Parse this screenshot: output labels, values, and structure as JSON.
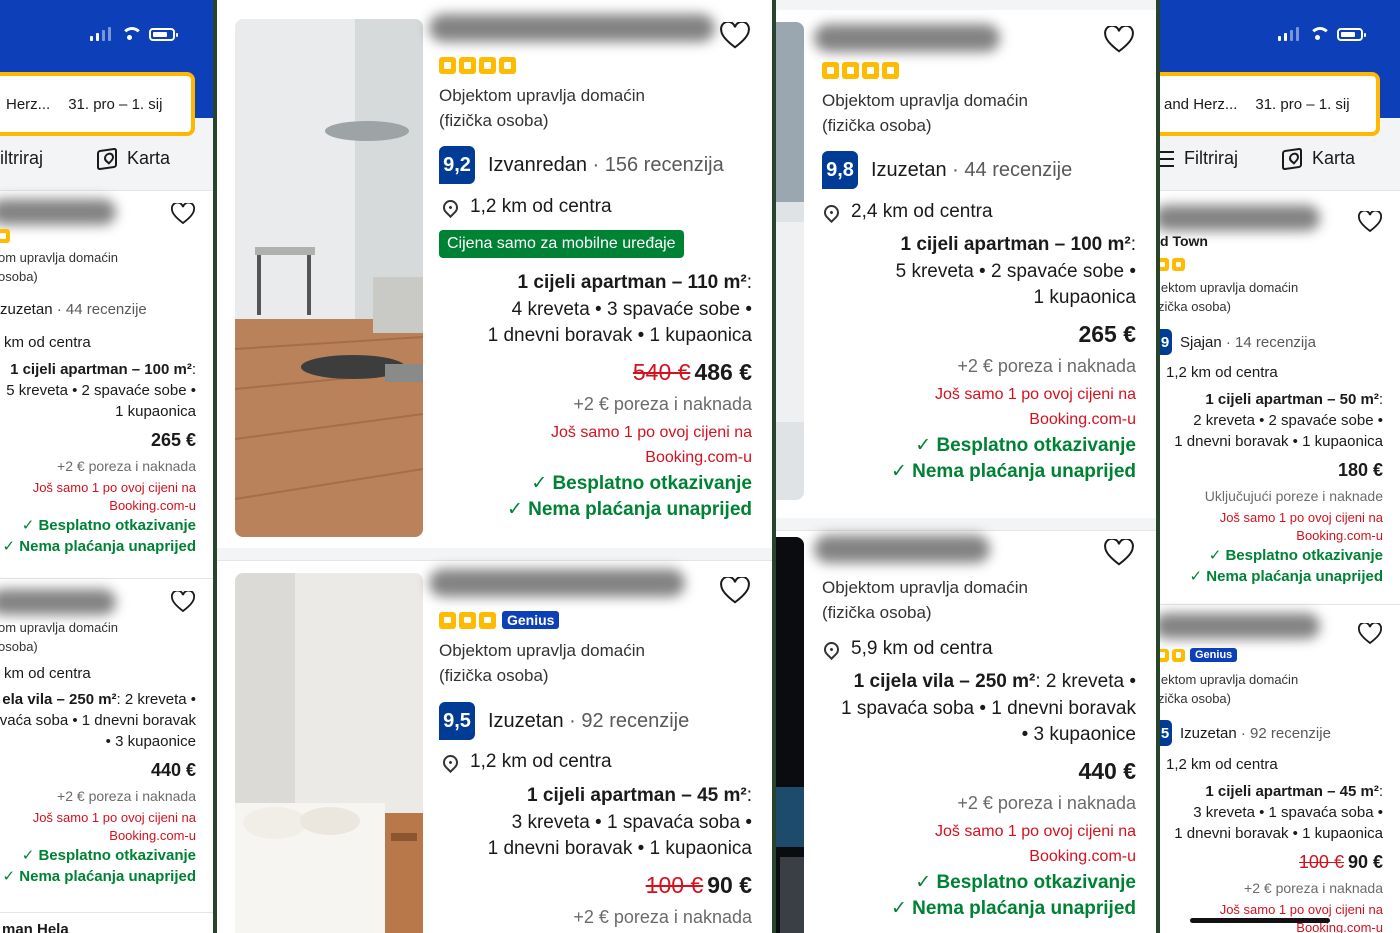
{
  "colors": {
    "booking_blue": "#0d3fb8",
    "score_blue": "#003b95",
    "search_border": "#ffb700",
    "star_yellow": "#febb02",
    "green": "#008234",
    "red": "#d4111e"
  },
  "icons": [
    "signal-icon",
    "wifi-icon",
    "battery-icon",
    "filter-icon",
    "map-icon",
    "heart-icon",
    "location-pin-icon",
    "check-icon",
    "star-icon"
  ],
  "panel1": {
    "search": {
      "place": "Herz...",
      "dates": "31. pro  –  1. sij"
    },
    "toolbar": {
      "filter": "iltriraj",
      "map": "Karta"
    },
    "cards": [
      {
        "host": "om upravlja domaćin",
        "host2": "osoba)",
        "rating_word": "zuzetan",
        "reviews": "· 44 recenzije",
        "distance": "km od centra",
        "unit": "1 cijeli apartman – 100 m²",
        "unit_tail": ":",
        "line2": "5 kreveta • 2 spavaće sobe •",
        "line3": "1 kupaonica",
        "price": "265 €",
        "tax": "+2 € poreza i naknada",
        "scarce1": "Još samo 1 po ovoj cijeni na",
        "scarce2": "Booking.com-u",
        "free_cancel": "Besplatno otkazivanje",
        "no_prepay": "Nema plaćanja unaprijed"
      },
      {
        "host": "om upravlja domaćin",
        "host2": "osoba)",
        "distance": "km od centra",
        "unit": "ela vila – 250 m²",
        "unit_tail": ": 2 kreveta •",
        "line2": "vaća soba • 1 dnevni boravak",
        "line3": "• 3 kupaonice",
        "price": "440 €",
        "tax": "+2 € poreza i naknada",
        "scarce1": "Još samo 1 po ovoj cijeni na",
        "scarce2": "Booking.com-u",
        "free_cancel": "Besplatno otkazivanje",
        "no_prepay": "Nema plaćanja unaprijed"
      }
    ],
    "next_title": "man Hela"
  },
  "panel2": {
    "cards": [
      {
        "host": "Objektom upravlja domaćin",
        "host2": "(fizička osoba)",
        "score": "9,2",
        "rating_word": "Izvanredan",
        "reviews": "· 156 recenzija",
        "distance": "1,2 km od centra",
        "mobile_price": "Cijena samo za mobilne uređaje",
        "unit": "1 cijeli apartman – 110 m²",
        "unit_tail": ":",
        "line2": "4 kreveta • 3 spavaće sobe •",
        "line3": "1 dnevni boravak • 1 kupaonica",
        "old_price": "540 €",
        "price": "486 €",
        "tax": "+2 € poreza i naknada",
        "scarce1": "Još samo 1 po ovoj cijeni na",
        "scarce2": "Booking.com-u",
        "free_cancel": "Besplatno otkazivanje",
        "no_prepay": "Nema plaćanja unaprijed"
      },
      {
        "genius": "Genius",
        "host": "Objektom upravlja domaćin",
        "host2": "(fizička osoba)",
        "score": "9,5",
        "rating_word": "Izuzetan",
        "reviews": "· 92 recenzije",
        "distance": "1,2 km od centra",
        "unit": "1 cijeli apartman – 45 m²",
        "unit_tail": ":",
        "line2": "3 kreveta • 1 spavaća soba •",
        "line3": "1 dnevni boravak • 1 kupaonica",
        "old_price": "100 €",
        "price": "90 €",
        "tax": "+2 € poreza i naknada"
      }
    ]
  },
  "panel3": {
    "cards": [
      {
        "host": "Objektom upravlja domaćin",
        "host2": "(fizička osoba)",
        "score": "9,8",
        "rating_word": "Izuzetan",
        "reviews": "· 44 recenzije",
        "distance": "2,4 km od centra",
        "unit": "1 cijeli apartman – 100 m²",
        "unit_tail": ":",
        "line2": "5 kreveta • 2 spavaće sobe •",
        "line3": "1 kupaonica",
        "price": "265 €",
        "tax": "+2 € poreza i naknada",
        "scarce1": "Još samo 1 po ovoj cijeni na",
        "scarce2": "Booking.com-u",
        "free_cancel": "Besplatno otkazivanje",
        "no_prepay": "Nema plaćanja unaprijed"
      },
      {
        "host": "Objektom upravlja domaćin",
        "host2": "(fizička osoba)",
        "distance": "5,9 km od centra",
        "unit": "1 cijela vila – 250 m²",
        "unit_tail": ": 2 kreveta •",
        "line2": "1 spavaća soba • 1 dnevni boravak",
        "line3": "• 3 kupaonice",
        "price": "440 €",
        "tax": "+2 € poreza i naknada",
        "scarce1": "Još samo 1 po ovoj cijeni na",
        "scarce2": "Booking.com-u",
        "free_cancel": "Besplatno otkazivanje",
        "no_prepay": "Nema plaćanja unaprijed"
      }
    ]
  },
  "panel4": {
    "search": {
      "place": "and Herz...",
      "dates": "31. pro  –  1. sij"
    },
    "toolbar": {
      "filter": "Filtriraj",
      "map": "Karta"
    },
    "cards": [
      {
        "title_tail": "d Town",
        "host": "jektom upravlja domaćin",
        "host2": "zička osoba)",
        "score": "9",
        "rating_word": "Sjajan",
        "reviews": "· 14 recenzija",
        "distance": "1,2 km od centra",
        "unit": "1 cijeli apartman – 50 m²",
        "unit_tail": ":",
        "line2": "2 kreveta • 2 spavaće sobe •",
        "line3": "1 dnevni boravak • 1 kupaonica",
        "price": "180 €",
        "tax": "Uključujući poreze i naknade",
        "scarce1": "Još samo 1 po ovoj cijeni na",
        "scarce2": "Booking.com-u",
        "free_cancel": "Besplatno otkazivanje",
        "no_prepay": "Nema plaćanja unaprijed"
      },
      {
        "genius": "Genius",
        "host": "jektom upravlja domaćin",
        "host2": "zička osoba)",
        "score": "5",
        "rating_word": "Izuzetan",
        "reviews": "· 92 recenzije",
        "distance": "1,2 km od centra",
        "unit": "1 cijeli apartman – 45 m²",
        "unit_tail": ":",
        "line2": "3 kreveta • 1 spavaća soba •",
        "line3": "1 dnevni boravak • 1 kupaonica",
        "old_price": "100 €",
        "price": "90 €",
        "tax": "+2 € poreza i naknada",
        "scarce1": "Još samo 1 po ovoj cijeni na",
        "scarce2": "Booking.com-u"
      }
    ]
  }
}
